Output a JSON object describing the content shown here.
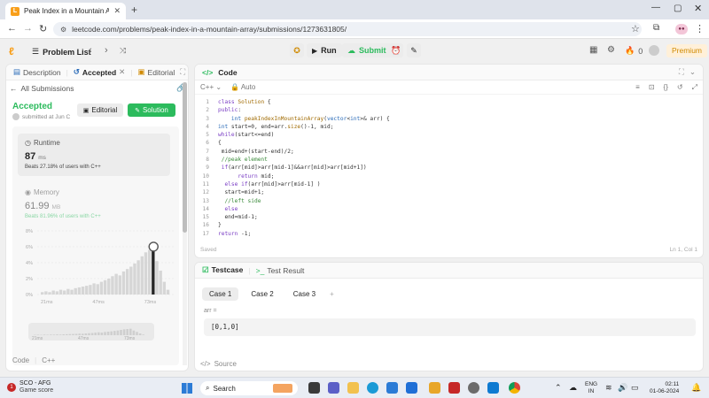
{
  "browser": {
    "tab_title": "Peak Index in a Mountain Arra",
    "url": "leetcode.com/problems/peak-index-in-a-mountain-array/submissions/1273631805/",
    "profile": "●●"
  },
  "header": {
    "problem_list": "Problem List",
    "run": "Run",
    "submit": "Submit",
    "streak": "0",
    "premium": "Premium"
  },
  "left": {
    "tabs": [
      "Description",
      "Accepted",
      "Editorial"
    ],
    "all_subs": "All Submissions",
    "status": "Accepted",
    "submitted": "submitted at Jun C",
    "editorial_btn": "Editorial",
    "solution_btn": "Solution",
    "runtime_label": "Runtime",
    "runtime_val": "87",
    "runtime_unit": "ms",
    "runtime_beats": "Beats 27.18% of users with C++",
    "memory_label": "Memory",
    "memory_val": "61.99",
    "memory_unit": "MB",
    "memory_beats": "Beats 81.96% of users with C++",
    "code_label": "Code",
    "lang": "C++"
  },
  "chart_data": {
    "type": "bar",
    "title": "",
    "yticks": [
      "8%",
      "6%",
      "4%",
      "2%",
      "0%"
    ],
    "xticks": [
      "21ms",
      "47ms",
      "73ms"
    ],
    "ylim": [
      0,
      8
    ],
    "values": [
      0.3,
      0.4,
      0.3,
      0.5,
      0.4,
      0.6,
      0.5,
      0.7,
      0.6,
      0.8,
      0.9,
      1.0,
      1.1,
      1.2,
      1.4,
      1.3,
      1.6,
      1.8,
      2.0,
      2.3,
      2.6,
      2.4,
      2.9,
      3.2,
      3.5,
      3.9,
      4.3,
      4.8,
      5.3,
      5.6,
      5.9,
      4.2,
      3.0,
      1.6,
      0.6
    ],
    "highlight_index": 30,
    "grid": true
  },
  "mini_ticks": [
    "21ms",
    "47ms",
    "73ms"
  ],
  "code_panel": {
    "title": "Code",
    "lang": "C++",
    "mode": "Auto",
    "saved": "Saved",
    "cursor": "Ln 1, Col 1",
    "lines": [
      "class Solution {",
      "public:",
      "    int peakIndexInMountainArray(vector<int>& arr) {",
      "int start=0, end=arr.size()-1, mid;",
      "while(start<=end)",
      "{",
      " mid=end+(start-end)/2;",
      " //peak element",
      " if(arr[mid]>arr[mid-1]&&arr[mid]>arr[mid+1])",
      "      return mid;",
      "  else if(arr[mid]>arr[mid-1] )",
      "  start=mid+1;",
      "  //left side",
      "  else",
      "  end=mid-1;",
      "}",
      "return -1;"
    ]
  },
  "testcase": {
    "tab1": "Testcase",
    "tab2": "Test Result",
    "cases": [
      "Case 1",
      "Case 2",
      "Case 3"
    ],
    "var": "arr =",
    "value": "[0,1,0]",
    "source": "Source"
  },
  "taskbar": {
    "weather_title": "SCO - AFG",
    "weather_sub": "Game score",
    "search": "Search",
    "lang1": "ENG",
    "lang2": "IN",
    "time": "02:11",
    "date": "01-06-2024",
    "badge": "1"
  }
}
